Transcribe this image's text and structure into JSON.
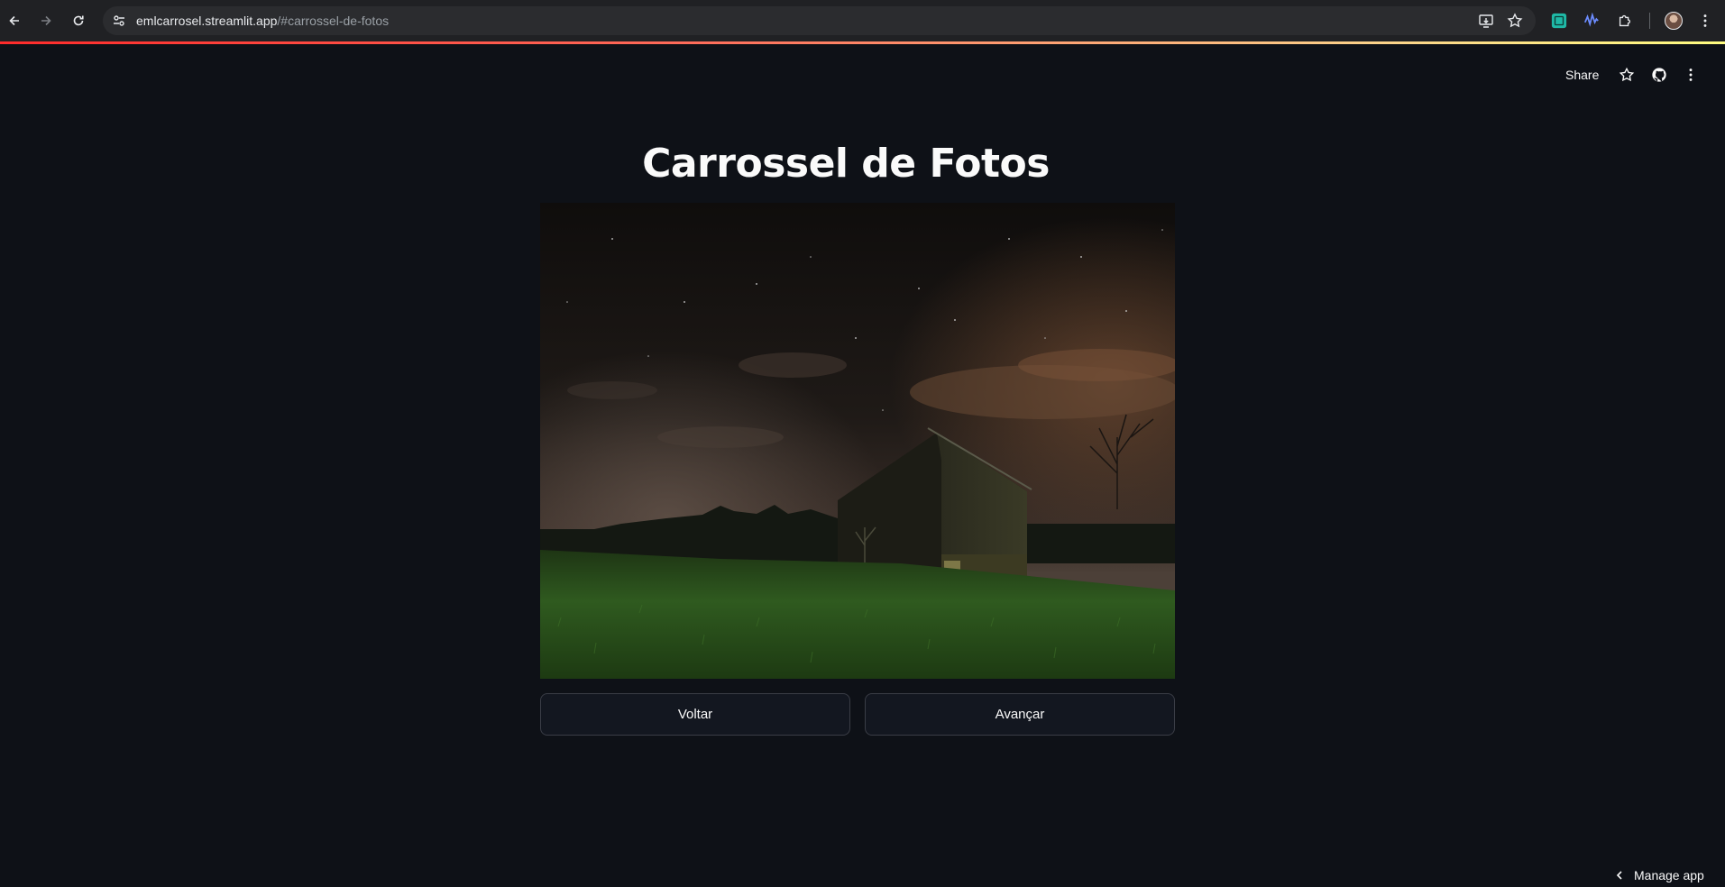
{
  "browser": {
    "url_domain": "emlcarrosel.streamlit.app",
    "url_path": "/#carrossel-de-fotos",
    "icons": [
      "back-icon",
      "forward-icon",
      "reload-icon",
      "site-settings-icon",
      "install-app-icon",
      "bookmark-star-icon",
      "extension-icon",
      "extension-icon",
      "puzzle-icon",
      "profile-avatar",
      "more-icon"
    ]
  },
  "header": {
    "share_label": "Share",
    "icons": [
      "star-icon",
      "github-icon",
      "more-vertical-icon"
    ]
  },
  "main": {
    "title": "Carrossel de Fotos",
    "image_alt": "Barn under a starry night sky",
    "buttons": {
      "back_label": "Voltar",
      "next_label": "Avançar"
    }
  },
  "footer": {
    "manage_label": "Manage app"
  },
  "colors": {
    "background": "#0e1117",
    "text": "#fafafa",
    "button_bg": "#131720",
    "button_border": "#3a3d46"
  }
}
